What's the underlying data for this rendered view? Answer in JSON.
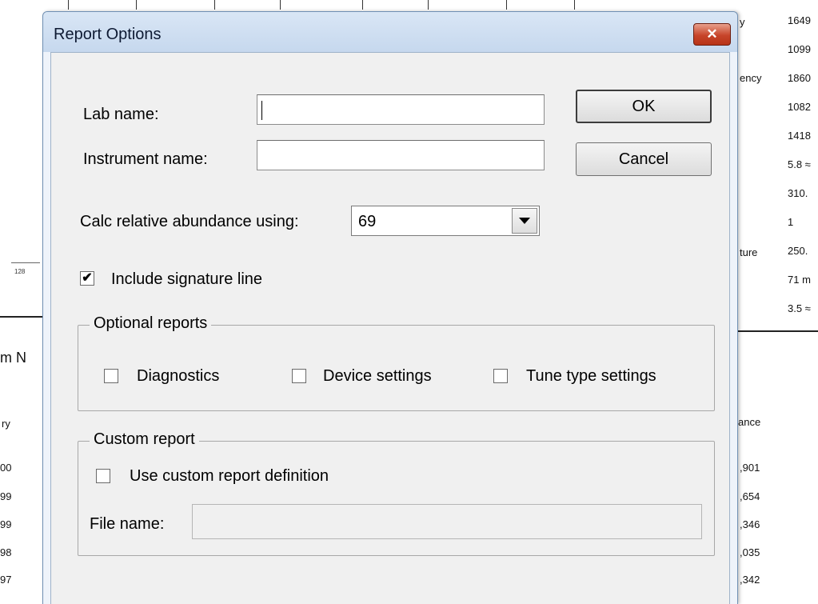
{
  "background": {
    "right_values": [
      "1649",
      "1099",
      "1860",
      "1082",
      "1418",
      "5.8 ≈",
      "310.",
      "1",
      "250.",
      "71 m",
      "3.5 ≈"
    ],
    "right_partial_labels": [
      "y",
      "ency",
      "ture",
      "ance"
    ],
    "bottom_values": [
      ",901",
      ",654",
      ",346",
      ",035",
      ",342"
    ],
    "left_fragments": [
      "m N",
      "ry",
      "00",
      "99",
      "99",
      "98",
      "97"
    ],
    "mini_label": "128"
  },
  "dialog": {
    "title": "Report Options",
    "close_symbol": "✕",
    "lab_name_label": "Lab name:",
    "lab_name_value": "",
    "instrument_name_label": "Instrument name:",
    "instrument_name_value": "",
    "ok_label": "OK",
    "cancel_label": "Cancel",
    "calc_label": "Calc relative abundance using:",
    "calc_value": "69",
    "include_signature_label": "Include signature line",
    "include_signature_checked": true,
    "optional_reports": {
      "legend": "Optional reports",
      "diagnostics_label": "Diagnostics",
      "device_settings_label": "Device settings",
      "tune_type_settings_label": "Tune type settings"
    },
    "custom_report": {
      "legend": "Custom report",
      "use_custom_label": "Use custom report definition",
      "file_name_label": "File name:",
      "file_name_value": ""
    },
    "check_mark": "✔"
  }
}
